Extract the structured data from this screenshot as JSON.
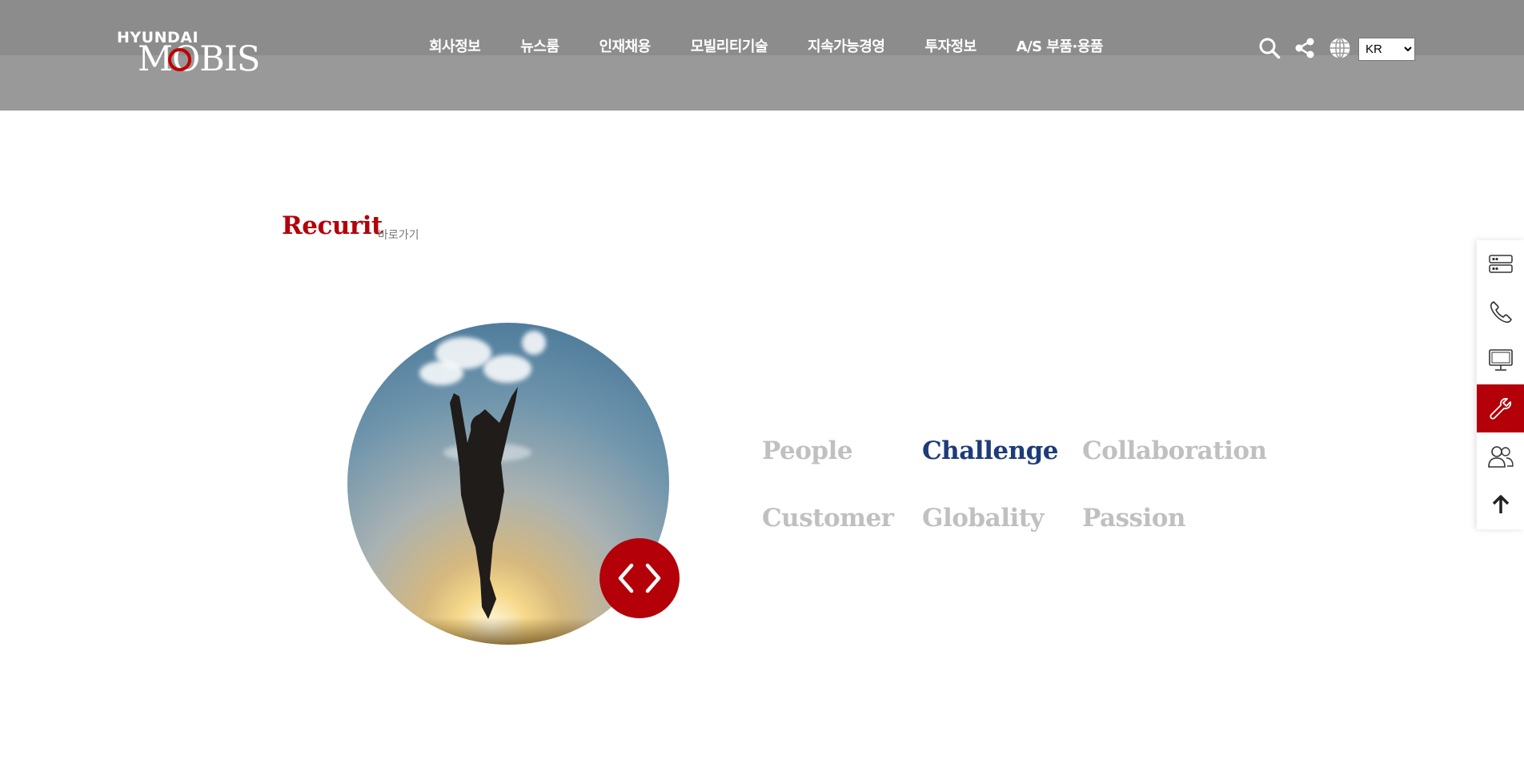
{
  "header": {
    "logo": {
      "brand_top": "HYUNDAI",
      "brand_bottom": "MOBIS"
    },
    "nav": [
      {
        "label": "회사정보"
      },
      {
        "label": "뉴스룸"
      },
      {
        "label": "인재채용"
      },
      {
        "label": "모빌리티기술"
      },
      {
        "label": "지속가능경영"
      },
      {
        "label": "투자정보"
      },
      {
        "label": "A/S 부품·용품"
      }
    ],
    "icons": [
      "search-icon",
      "share-icon",
      "globe-icon"
    ],
    "language": {
      "selected": "KR",
      "options": [
        "KR"
      ]
    }
  },
  "section": {
    "title": "Recurit",
    "link_label": "바로가기"
  },
  "carousel": {
    "arrows": {
      "prev": "chevron-left-icon",
      "next": "chevron-right-icon"
    }
  },
  "values": [
    {
      "label": "People",
      "active": false
    },
    {
      "label": "Challenge",
      "active": true
    },
    {
      "label": "Collaboration",
      "active": false
    },
    {
      "label": "Customer",
      "active": false
    },
    {
      "label": "Globality",
      "active": false
    },
    {
      "label": "Passion",
      "active": false
    }
  ],
  "quick_bar": {
    "items": [
      {
        "icon": "server-icon",
        "active": false
      },
      {
        "icon": "phone-icon",
        "active": false
      },
      {
        "icon": "monitor-icon",
        "active": false
      },
      {
        "icon": "wrench-icon",
        "active": true
      },
      {
        "icon": "users-icon",
        "active": false
      },
      {
        "icon": "arrow-up-icon",
        "active": false
      }
    ]
  },
  "colors": {
    "brand_red": "#b30009",
    "active_value": "#1d3c78",
    "inactive_value": "#c0c0c0",
    "header_bg": "#8c8c8c"
  }
}
